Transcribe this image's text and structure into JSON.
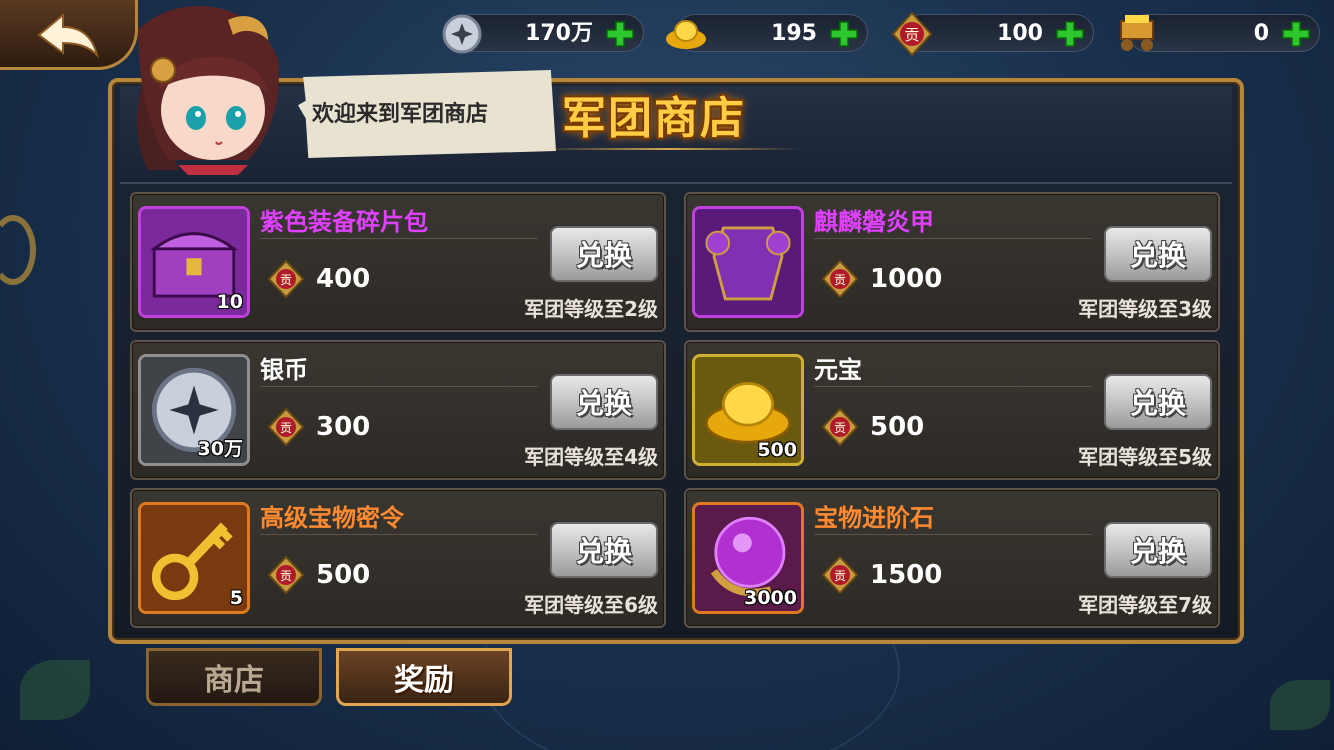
{
  "top_bar": {
    "currencies": [
      {
        "icon": "silver-coin-icon",
        "value": "170万"
      },
      {
        "icon": "gold-ingot-icon",
        "value": "195"
      },
      {
        "icon": "contribution-badge-icon",
        "value": "100"
      },
      {
        "icon": "treasure-cart-icon",
        "value": "0"
      }
    ]
  },
  "header": {
    "speech": "欢迎来到军团商店",
    "title": "军团商店"
  },
  "price_badge_label": "贡",
  "exchange_label": "兑换",
  "items": [
    {
      "name": "紫色装备碎片包",
      "name_color": "#e040ff",
      "price": "400",
      "qty": "10",
      "requirement": "军团等级至2级",
      "frame": "#c040e0",
      "icon": "purple-chest-icon"
    },
    {
      "name": "麒麟磐炎甲",
      "name_color": "#e040ff",
      "price": "1000",
      "qty": "",
      "requirement": "军团等级至3级",
      "frame": "#c040e0",
      "icon": "purple-armor-icon"
    },
    {
      "name": "银币",
      "name_color": "#ffffff",
      "price": "300",
      "qty": "30万",
      "requirement": "军团等级至4级",
      "frame": "#909090",
      "icon": "silver-coin-icon"
    },
    {
      "name": "元宝",
      "name_color": "#ffffff",
      "price": "500",
      "qty": "500",
      "requirement": "军团等级至5级",
      "frame": "#d0b030",
      "icon": "gold-ingot-icon"
    },
    {
      "name": "高级宝物密令",
      "name_color": "#ff8a30",
      "price": "500",
      "qty": "5",
      "requirement": "军团等级至6级",
      "frame": "#e07a20",
      "icon": "golden-key-icon"
    },
    {
      "name": "宝物进阶石",
      "name_color": "#ff8a30",
      "price": "1500",
      "qty": "3000",
      "requirement": "军团等级至7级",
      "frame": "#e07a20",
      "icon": "purple-gem-icon"
    }
  ],
  "tabs": [
    {
      "label": "商店",
      "active": false
    },
    {
      "label": "奖励",
      "active": true
    }
  ]
}
